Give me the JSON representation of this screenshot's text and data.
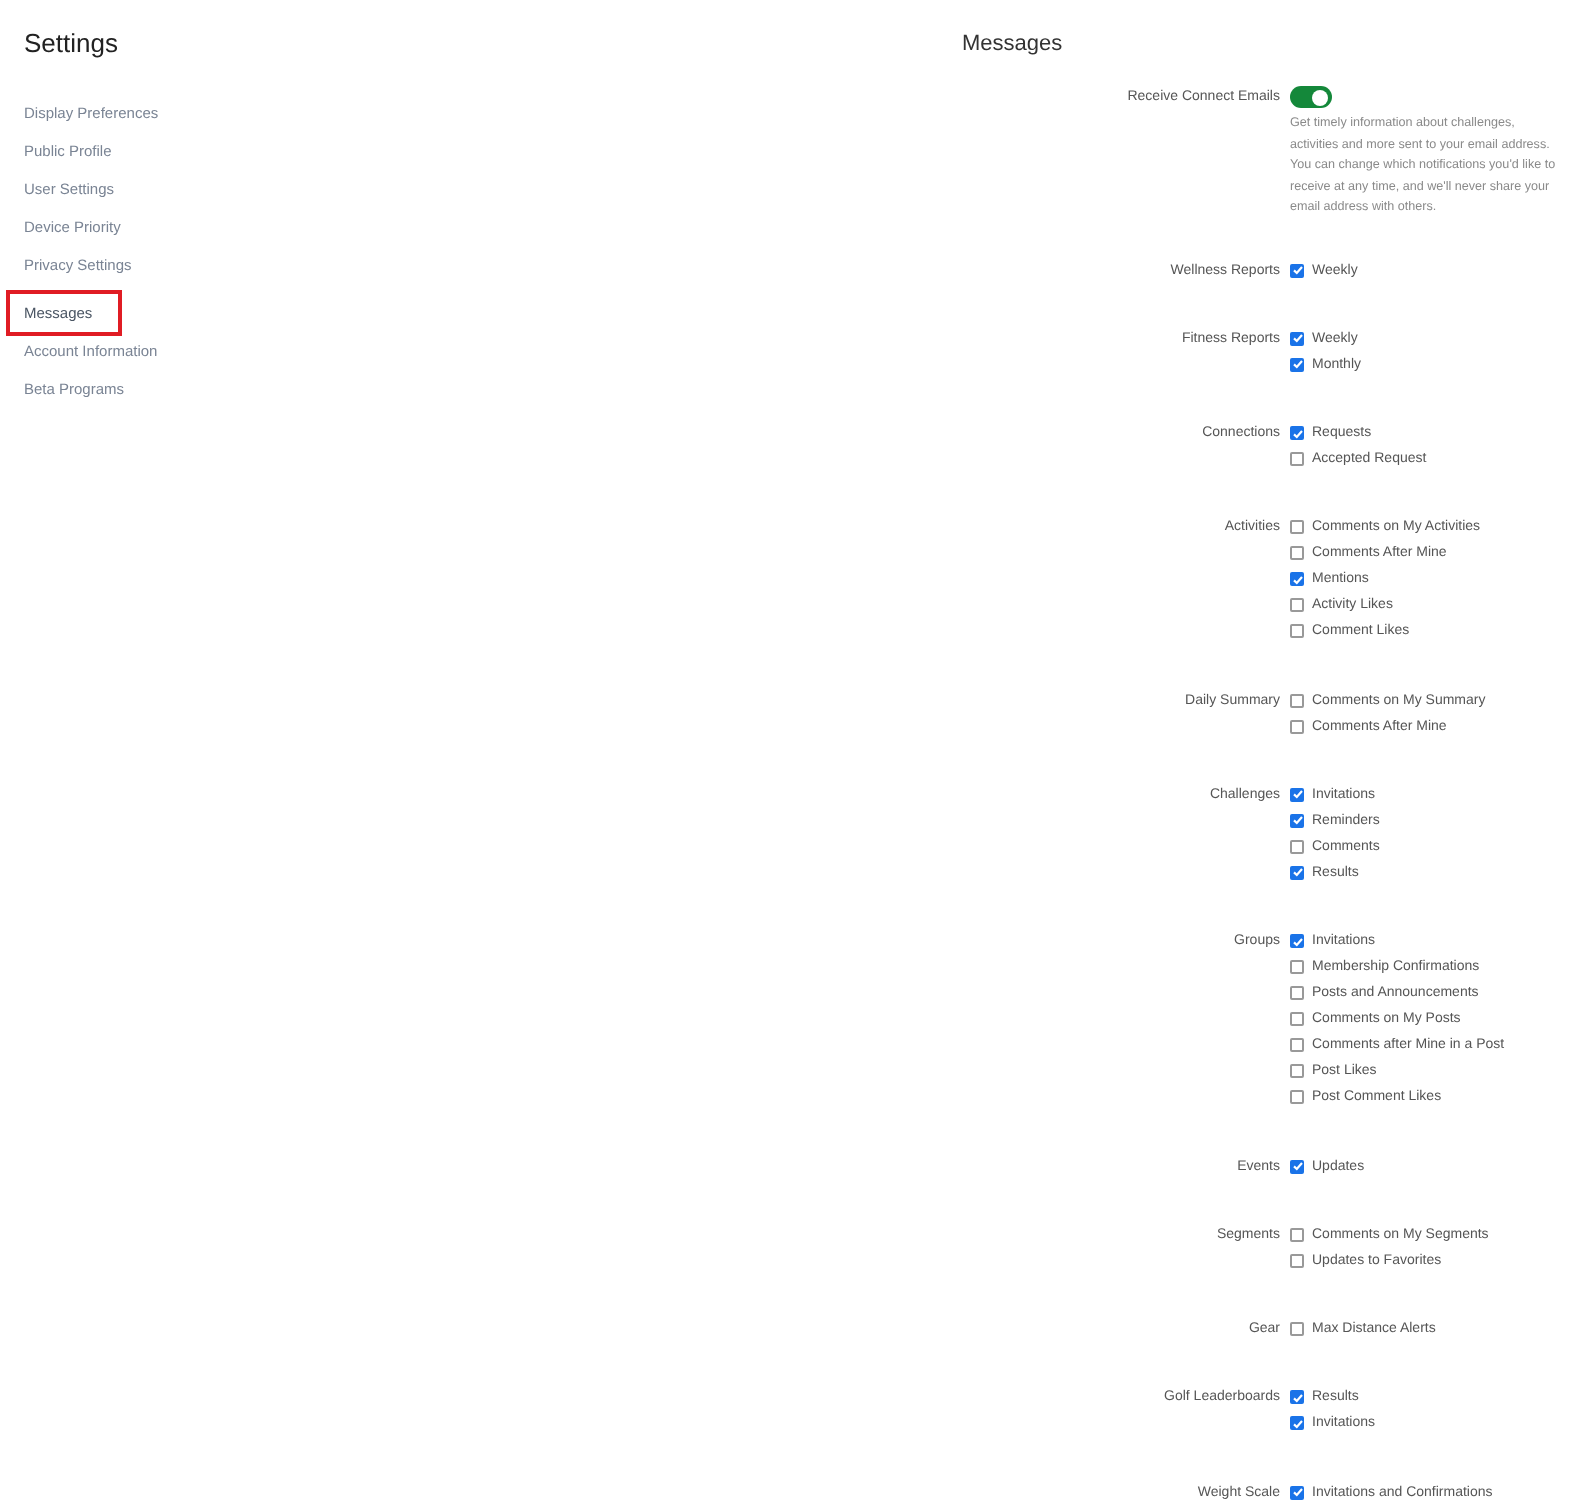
{
  "sidebar": {
    "title": "Settings",
    "items": [
      {
        "label": "Display Preferences",
        "selected": false
      },
      {
        "label": "Public Profile",
        "selected": false
      },
      {
        "label": "User Settings",
        "selected": false
      },
      {
        "label": "Device Priority",
        "selected": false
      },
      {
        "label": "Privacy Settings",
        "selected": false
      },
      {
        "label": "Messages",
        "selected": true
      },
      {
        "label": "Account Information",
        "selected": false
      },
      {
        "label": "Beta Programs",
        "selected": false
      }
    ]
  },
  "main": {
    "title": "Messages",
    "email_toggle": {
      "label": "Receive Connect Emails",
      "on": true,
      "description": "Get timely information about challenges, activities and more sent to your email address. You can change which notifications you'd like to receive at any time, and we'll never share your email address with others."
    },
    "groups": [
      {
        "label": "Wellness Reports",
        "options": [
          {
            "label": "Weekly",
            "checked": true
          }
        ]
      },
      {
        "label": "Fitness Reports",
        "options": [
          {
            "label": "Weekly",
            "checked": true
          },
          {
            "label": "Monthly",
            "checked": true
          }
        ]
      },
      {
        "label": "Connections",
        "options": [
          {
            "label": "Requests",
            "checked": true
          },
          {
            "label": "Accepted Request",
            "checked": false
          }
        ]
      },
      {
        "label": "Activities",
        "options": [
          {
            "label": "Comments on My Activities",
            "checked": false
          },
          {
            "label": "Comments After Mine",
            "checked": false
          },
          {
            "label": "Mentions",
            "checked": true
          },
          {
            "label": "Activity Likes",
            "checked": false
          },
          {
            "label": "Comment Likes",
            "checked": false
          }
        ]
      },
      {
        "label": "Daily Summary",
        "options": [
          {
            "label": "Comments on My Summary",
            "checked": false
          },
          {
            "label": "Comments After Mine",
            "checked": false
          }
        ]
      },
      {
        "label": "Challenges",
        "options": [
          {
            "label": "Invitations",
            "checked": true
          },
          {
            "label": "Reminders",
            "checked": true
          },
          {
            "label": "Comments",
            "checked": false
          },
          {
            "label": "Results",
            "checked": true
          }
        ]
      },
      {
        "label": "Groups",
        "options": [
          {
            "label": "Invitations",
            "checked": true
          },
          {
            "label": "Membership Confirmations",
            "checked": false
          },
          {
            "label": "Posts and Announcements",
            "checked": false
          },
          {
            "label": "Comments on My Posts",
            "checked": false
          },
          {
            "label": "Comments after Mine in a Post",
            "checked": false
          },
          {
            "label": "Post Likes",
            "checked": false
          },
          {
            "label": "Post Comment Likes",
            "checked": false
          }
        ]
      },
      {
        "label": "Events",
        "options": [
          {
            "label": "Updates",
            "checked": true
          }
        ]
      },
      {
        "label": "Segments",
        "options": [
          {
            "label": "Comments on My Segments",
            "checked": false
          },
          {
            "label": "Updates to Favorites",
            "checked": false
          }
        ]
      },
      {
        "label": "Gear",
        "options": [
          {
            "label": "Max Distance Alerts",
            "checked": false
          }
        ]
      },
      {
        "label": "Golf Leaderboards",
        "options": [
          {
            "label": "Results",
            "checked": true
          },
          {
            "label": "Invitations",
            "checked": true
          }
        ]
      },
      {
        "label": "Weight Scale",
        "options": [
          {
            "label": "Invitations and Confirmations",
            "checked": true
          }
        ]
      }
    ]
  }
}
